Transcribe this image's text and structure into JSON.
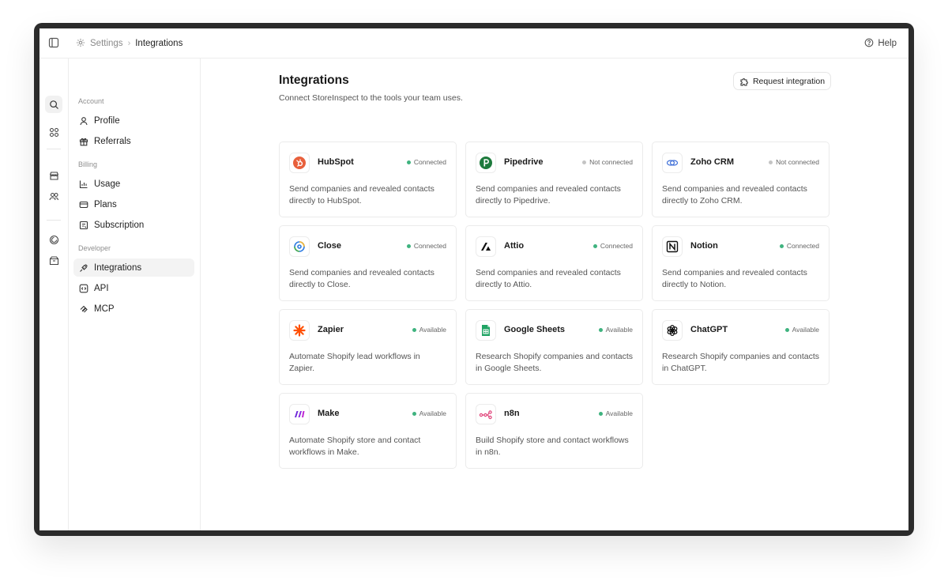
{
  "breadcrumb": {
    "parent": "Settings",
    "separator": "›",
    "current": "Integrations"
  },
  "header": {
    "help_label": "Help"
  },
  "rail": {
    "icons": [
      "search-icon",
      "grid-icon",
      "store-icon",
      "team-icon",
      "analytics-icon",
      "box-icon"
    ]
  },
  "sidebar": {
    "sections": [
      {
        "label": "Account",
        "items": [
          {
            "label": "Profile",
            "icon": "user-icon"
          },
          {
            "label": "Referrals",
            "icon": "gift-icon"
          }
        ]
      },
      {
        "label": "Billing",
        "items": [
          {
            "label": "Usage",
            "icon": "chart-icon"
          },
          {
            "label": "Plans",
            "icon": "card-icon"
          },
          {
            "label": "Subscription",
            "icon": "receipt-icon"
          }
        ]
      },
      {
        "label": "Developer",
        "items": [
          {
            "label": "Integrations",
            "icon": "plug-icon",
            "active": true
          },
          {
            "label": "API",
            "icon": "code-icon"
          },
          {
            "label": "MCP",
            "icon": "mcp-icon"
          }
        ]
      }
    ]
  },
  "page": {
    "title": "Integrations",
    "subtitle": "Connect StoreInspect to the tools your team uses.",
    "request_button": "Request integration"
  },
  "status_colors": {
    "Connected": "#3fb37f",
    "Not connected": "#c4c4c4",
    "Available": "#3fb37f"
  },
  "integrations": [
    {
      "name": "HubSpot",
      "status": "Connected",
      "description": "Send companies and revealed contacts directly to HubSpot.",
      "icon": "hubspot-icon",
      "color": "#e8603c"
    },
    {
      "name": "Pipedrive",
      "status": "Not connected",
      "description": "Send companies and revealed contacts directly to Pipedrive.",
      "icon": "pipedrive-icon",
      "color": "#1d7a3c"
    },
    {
      "name": "Zoho CRM",
      "status": "Not connected",
      "description": "Send companies and revealed contacts directly to Zoho CRM.",
      "icon": "zoho-icon",
      "color": "#3f6fd8"
    },
    {
      "name": "Close",
      "status": "Connected",
      "description": "Send companies and revealed contacts directly to Close.",
      "icon": "close-icon",
      "color": "#2f7de1"
    },
    {
      "name": "Attio",
      "status": "Connected",
      "description": "Send companies and revealed contacts directly to Attio.",
      "icon": "attio-icon",
      "color": "#111111"
    },
    {
      "name": "Notion",
      "status": "Connected",
      "description": "Send companies and revealed contacts directly to Notion.",
      "icon": "notion-icon",
      "color": "#111111"
    },
    {
      "name": "Zapier",
      "status": "Available",
      "description": "Automate Shopify lead workflows in Zapier.",
      "icon": "zapier-icon",
      "color": "#ff4f00"
    },
    {
      "name": "Google Sheets",
      "status": "Available",
      "description": "Research Shopify companies and contacts in Google Sheets.",
      "icon": "sheets-icon",
      "color": "#21a464"
    },
    {
      "name": "ChatGPT",
      "status": "Available",
      "description": "Research Shopify companies and contacts in ChatGPT.",
      "icon": "chatgpt-icon",
      "color": "#111111"
    },
    {
      "name": "Make",
      "status": "Available",
      "description": "Automate Shopify store and contact workflows in Make.",
      "icon": "make-icon",
      "color": "#8a2be2"
    },
    {
      "name": "n8n",
      "status": "Available",
      "description": "Build Shopify store and contact workflows in n8n.",
      "icon": "n8n-icon",
      "color": "#e0447a"
    }
  ]
}
